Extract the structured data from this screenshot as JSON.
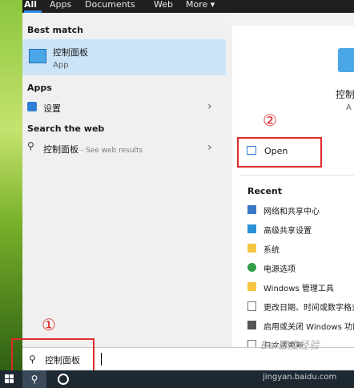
{
  "tabs": [
    "All",
    "Apps",
    "Documents",
    "Web",
    "More ▾"
  ],
  "best_match": {
    "heading": "Best match",
    "title": "控制面板",
    "subtitle": "App"
  },
  "apps": {
    "heading": "Apps",
    "items": [
      {
        "label": "设置"
      }
    ]
  },
  "search_web": {
    "heading": "Search the web",
    "query": "控制面板",
    "suffix": " - See web results"
  },
  "details": {
    "title": "控制",
    "subtitle": "A",
    "open_label": "Open"
  },
  "recent": {
    "heading": "Recent",
    "items": [
      {
        "label": "网络和共享中心",
        "icon": "network-icon"
      },
      {
        "label": "高级共享设置",
        "icon": "share-icon"
      },
      {
        "label": "系统",
        "icon": "folder-icon"
      },
      {
        "label": "电源选项",
        "icon": "power-icon"
      },
      {
        "label": "Windows 管理工具",
        "icon": "folder-icon"
      },
      {
        "label": "更改日期、时间或数字格式",
        "icon": "document-icon"
      },
      {
        "label": "启用或关闭 Windows 功能",
        "icon": "settings-icon"
      },
      {
        "label": "日立调更新",
        "icon": "document-icon"
      }
    ]
  },
  "search_box": {
    "value": "控制面板"
  },
  "annotations": [
    "①",
    "②"
  ],
  "watermark": "Bai百度经验",
  "watermark_url": "jingyan.baidu.com"
}
